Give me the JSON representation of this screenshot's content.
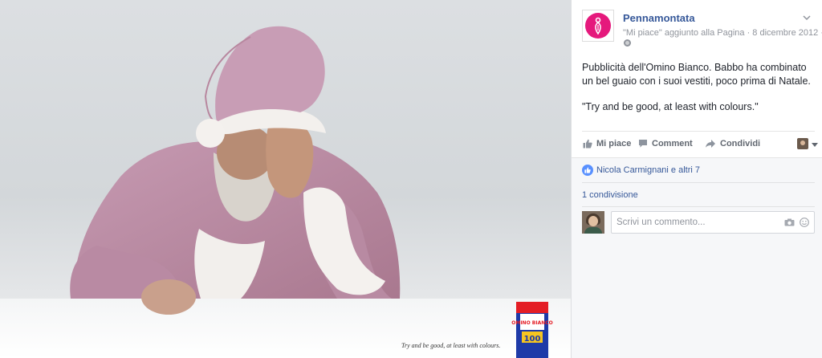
{
  "photo": {
    "tagline": "Try and be good, at least with colours.",
    "product_label": "OMINO BIANCO",
    "product_number": "100"
  },
  "post": {
    "page_name": "Pennamontata",
    "meta": "\"Mi piace\" aggiunto alla Pagina · 8 dicembre 2012 ·",
    "paragraph1": "Pubblicità dell'Omino Bianco. Babbo ha combinato un bel guaio con i suoi vestiti, poco prima di Natale.",
    "paragraph2": "\"Try and be good, at least with colours.\""
  },
  "actions": {
    "like_label": "Mi piace",
    "comment_label": "Comment",
    "share_label": "Condividi"
  },
  "reactions": {
    "likes_text": "Nicola Carmignani e altri 7",
    "shares_text": "1 condivisione"
  },
  "comment": {
    "placeholder": "Scrivi un commento..."
  },
  "colors": {
    "brand_pink": "#e5197c",
    "link_blue": "#365899",
    "like_blue": "#5890ff"
  }
}
